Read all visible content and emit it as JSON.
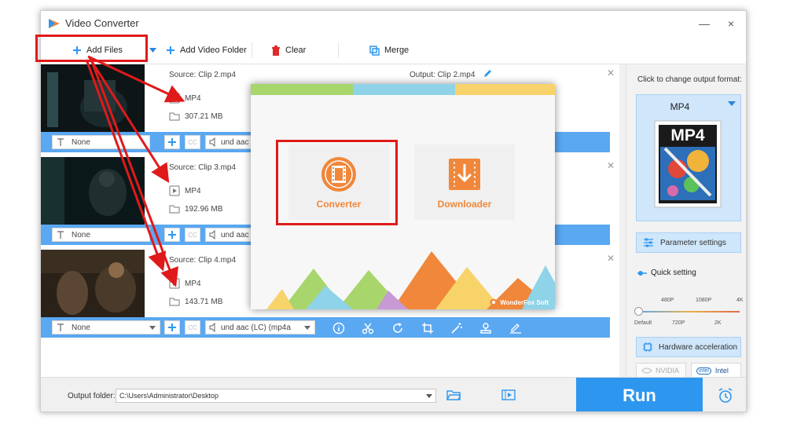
{
  "window": {
    "title": "Video Converter",
    "minimize": "—",
    "close": "×"
  },
  "toolbar": {
    "add_files": "Add Files",
    "add_folder": "Add Video Folder",
    "clear": "Clear",
    "merge": "Merge"
  },
  "files": [
    {
      "source": "Source: Clip 2.mp4",
      "format": "MP4",
      "size": "307.21 MB",
      "output": "Output: Clip 2.mp4",
      "subtitle": "None",
      "audio": "und aac"
    },
    {
      "source": "Source: Clip 3.mp4",
      "format": "MP4",
      "size": "192.96 MB",
      "subtitle": "None",
      "audio": "und aac"
    },
    {
      "source": "Source: Clip 4.mp4",
      "format": "MP4",
      "size": "143.71 MB",
      "subtitle": "None",
      "audio": "und aac (LC) (mp4a"
    }
  ],
  "right_panel": {
    "prompt": "Click to change output format:",
    "format": "MP4",
    "format_thumb_text": "MP4",
    "parameter_settings": "Parameter settings",
    "quick_setting": "Quick setting",
    "quality_top": [
      "480P",
      "1080P",
      "4K"
    ],
    "quality_bottom": [
      "Default",
      "720P",
      "2K"
    ],
    "quality_level": 0,
    "hw_accel": "Hardware acceleration",
    "nvidia": "NVIDIA",
    "intel": "Intel"
  },
  "bottom": {
    "output_folder_label": "Output folder:",
    "output_folder_value": "C:\\Users\\Administrator\\Desktop",
    "run": "Run"
  },
  "popup": {
    "converter": "Converter",
    "downloader": "Downloader",
    "brand": "WonderFox Soft"
  },
  "colors": {
    "accent_blue": "#2d97f0",
    "row_bar_blue": "#5aa8f2",
    "orange": "#f0873a",
    "highlight_red": "#e01a1a"
  }
}
